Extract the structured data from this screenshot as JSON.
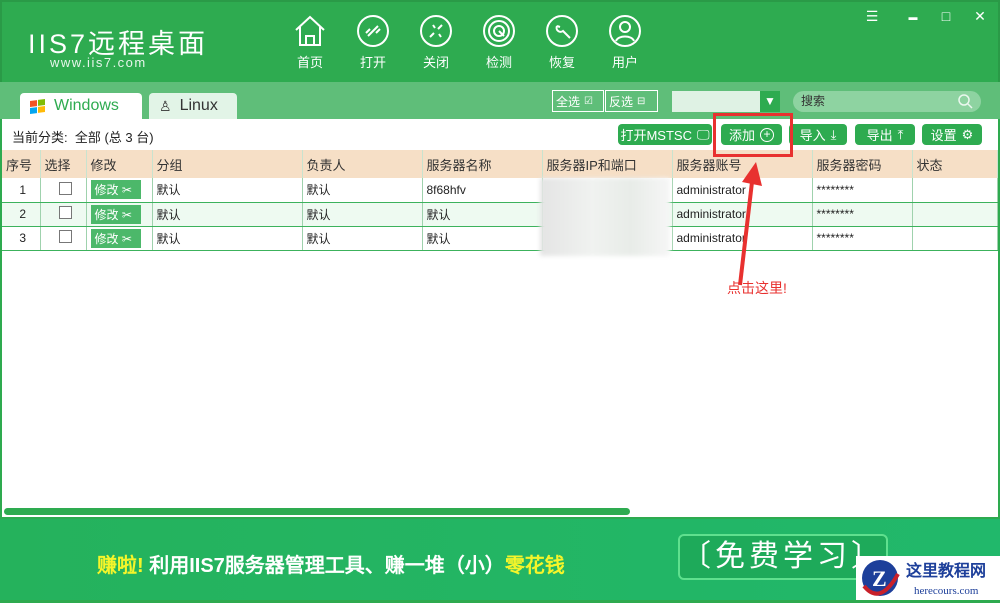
{
  "app": {
    "logo": "IIS7远程桌面",
    "url": "www.iis7.com"
  },
  "nav": [
    {
      "label": "首页",
      "icon": "home-icon"
    },
    {
      "label": "打开",
      "icon": "link-icon"
    },
    {
      "label": "关闭",
      "icon": "unlink-icon"
    },
    {
      "label": "检测",
      "icon": "radar-icon"
    },
    {
      "label": "恢复",
      "icon": "wrench-icon"
    },
    {
      "label": "用户",
      "icon": "user-icon"
    }
  ],
  "window": {
    "menu": "☰",
    "min": "▬",
    "max": "□",
    "close": "✕"
  },
  "tabs": [
    {
      "label": "Windows"
    },
    {
      "label": "Linux"
    }
  ],
  "select": {
    "all": "全选",
    "invert": "反选"
  },
  "search": {
    "placeholder": "搜索"
  },
  "category": {
    "label": "当前分类:",
    "value": "全部 (总 3 台)"
  },
  "toolbar": {
    "mstsc": "打开MSTSC",
    "add": "添加",
    "import": "导入",
    "export": "导出",
    "settings": "设置"
  },
  "table": {
    "headers": [
      "序号",
      "选择",
      "修改",
      "分组",
      "负责人",
      "服务器名称",
      "服务器IP和端口",
      "服务器账号",
      "服务器密码",
      "状态"
    ],
    "edit_label": "修改",
    "rows": [
      {
        "no": "1",
        "group": "默认",
        "owner": "默认",
        "name": "8f68hfv",
        "account": "administrator",
        "password": "********",
        "status": ""
      },
      {
        "no": "2",
        "group": "默认",
        "owner": "默认",
        "name": "默认",
        "account": "administrator",
        "password": "********",
        "status": ""
      },
      {
        "no": "3",
        "group": "默认",
        "owner": "默认",
        "name": "默认",
        "account": "administrator",
        "password": "********",
        "status": ""
      }
    ]
  },
  "annotation": {
    "text": "点击这里!",
    "color": "#e8312f"
  },
  "banner": {
    "p1": "赚啦!",
    "p2": "利用IIS7服务器管理工具、赚一堆（小）",
    "p3": "零花钱",
    "button": "〔免费学习〕"
  },
  "watermark": {
    "name": "这里教程网",
    "url": "herecours.com"
  },
  "colors": {
    "brand": "#2eab50",
    "header_bg": "#f6dfc6"
  }
}
